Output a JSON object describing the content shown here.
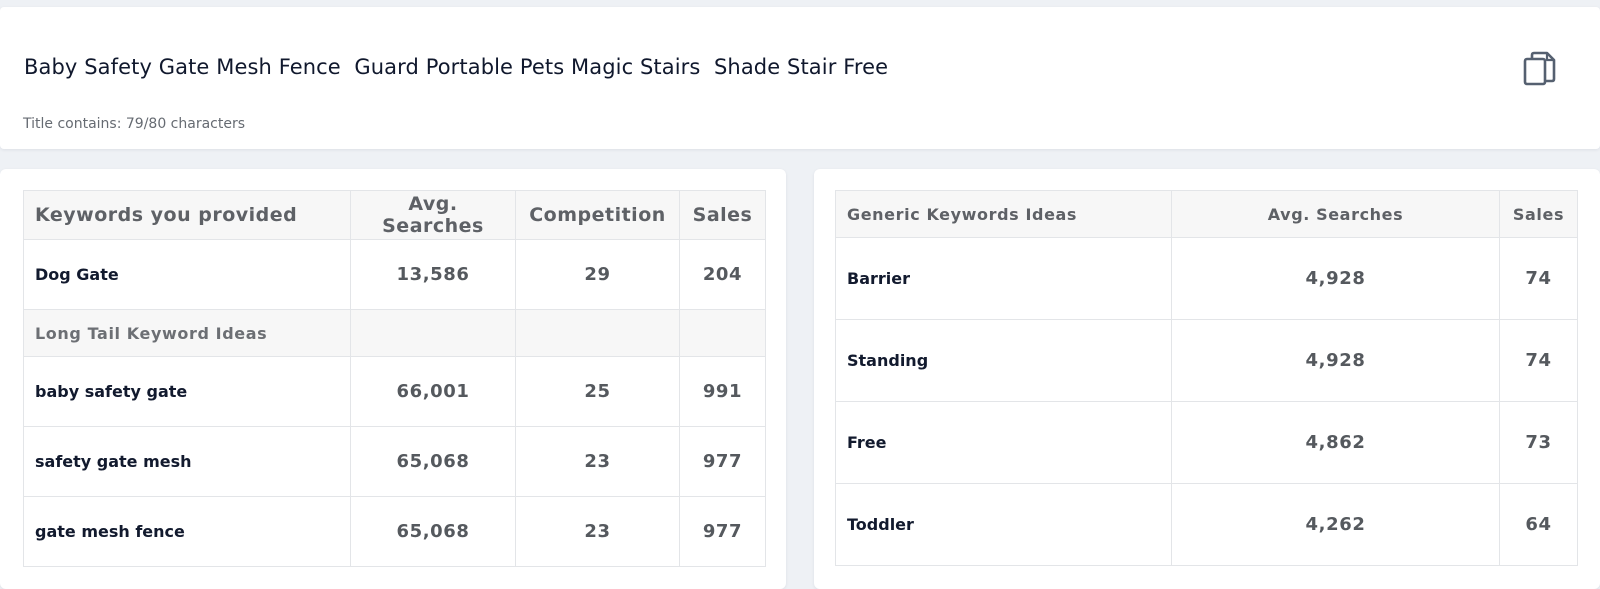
{
  "title_card": {
    "title": "Baby Safety Gate Mesh Fence  Guard Portable Pets Magic Stairs  Shade Stair Free",
    "char_count": "Title contains: 79/80 characters",
    "copy_icon": "copy-icon"
  },
  "provided_table": {
    "headers": [
      "Keywords you provided",
      "Avg. Searches",
      "Competition",
      "Sales"
    ],
    "rows": [
      {
        "keyword": "Dog Gate",
        "searches": "13,586",
        "competition": "29",
        "sales": "204"
      }
    ],
    "subheader": "Long Tail Keyword Ideas",
    "long_tail_rows": [
      {
        "keyword": "baby safety gate",
        "searches": "66,001",
        "competition": "25",
        "sales": "991"
      },
      {
        "keyword": "safety gate mesh",
        "searches": "65,068",
        "competition": "23",
        "sales": "977"
      },
      {
        "keyword": "gate mesh fence",
        "searches": "65,068",
        "competition": "23",
        "sales": "977"
      }
    ]
  },
  "generic_table": {
    "headers": [
      "Generic Keywords Ideas",
      "Avg. Searches",
      "Sales"
    ],
    "rows": [
      {
        "keyword": "Barrier",
        "searches": "4,928",
        "sales": "74"
      },
      {
        "keyword": "Standing",
        "searches": "4,928",
        "sales": "74"
      },
      {
        "keyword": "Free",
        "searches": "4,862",
        "sales": "73"
      },
      {
        "keyword": "Toddler",
        "searches": "4,262",
        "sales": "64"
      }
    ]
  }
}
